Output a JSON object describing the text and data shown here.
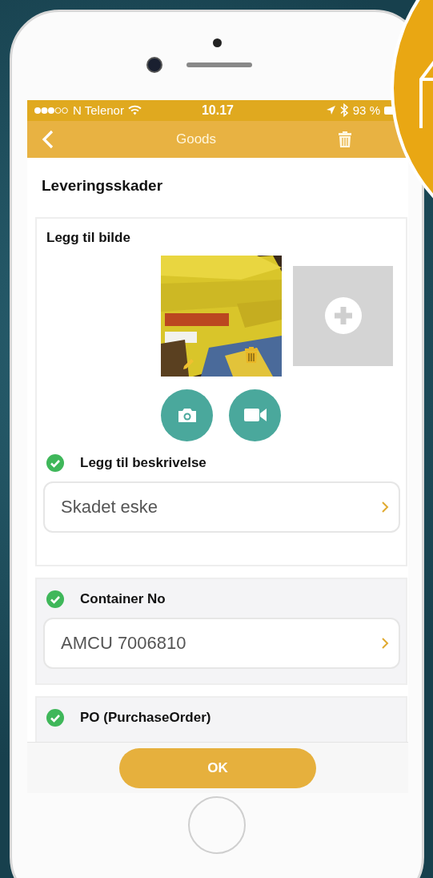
{
  "status_bar": {
    "carrier": "N Telenor",
    "time": "10.17",
    "battery": "93 %"
  },
  "nav": {
    "title": "Goods"
  },
  "page_title": "Leveringsskader",
  "photo_section": {
    "title": "Legg til bilde"
  },
  "fields": [
    {
      "label": "Legg til beskrivelse",
      "checked": true,
      "value": "Skadet eske"
    },
    {
      "label": "Container No",
      "checked": true,
      "value": "AMCU 7006810"
    },
    {
      "label": "PO (PurchaseOrder)",
      "checked": true
    }
  ],
  "ok_button": "OK"
}
